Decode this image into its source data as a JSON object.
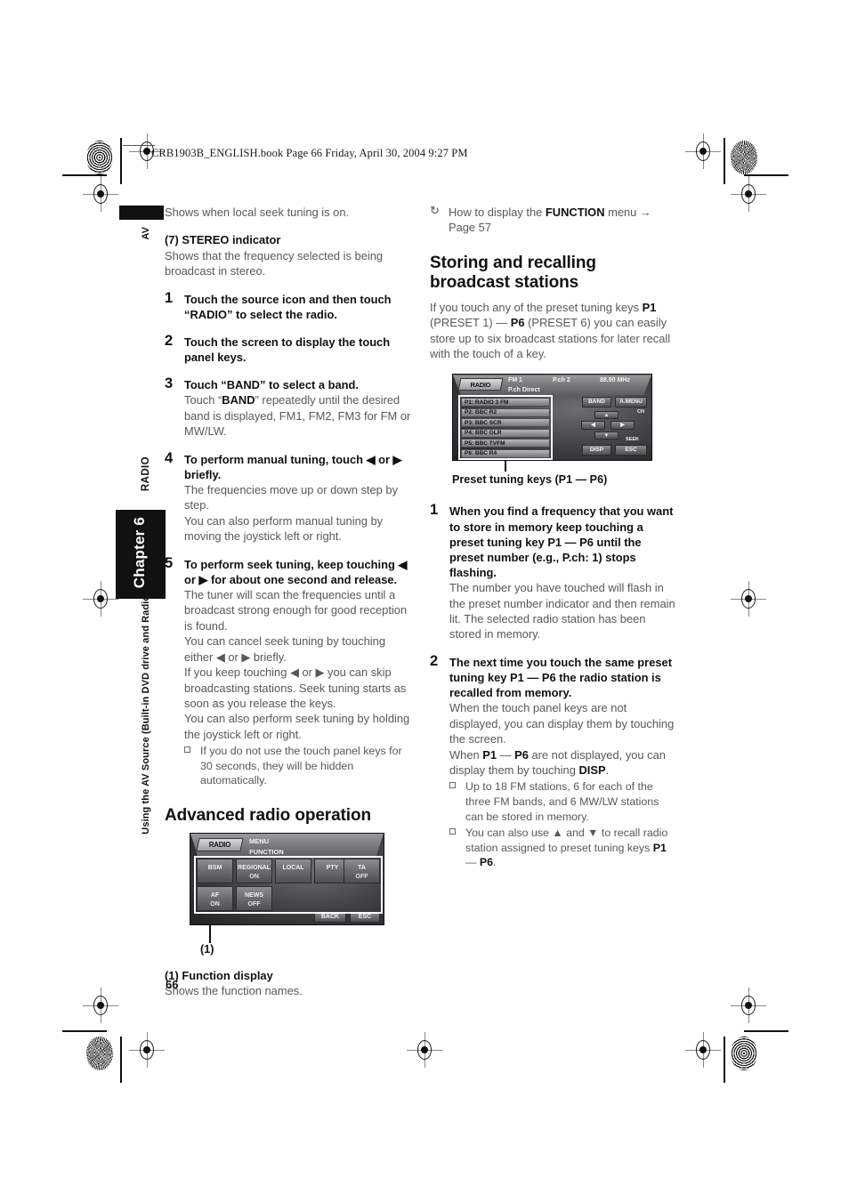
{
  "print_header": "CRB1903B_ENGLISH.book  Page 66  Friday, April 30, 2004  9:27 PM",
  "page_number": "66",
  "margin_tabs": {
    "av": "AV",
    "radio": "RADIO",
    "chapter": "Chapter 6",
    "section": "Using the AV Source (Built-in DVD drive and Radio)"
  },
  "left_column": {
    "local_note": "Shows when local seek tuning is on.",
    "stereo_heading": "(7) STEREO indicator",
    "stereo_body": "Shows that the frequency selected is being broadcast in stereo.",
    "steps": [
      {
        "number": "1",
        "head": "Touch the source icon and then touch “RADIO” to select the radio.",
        "body": []
      },
      {
        "number": "2",
        "head": "Touch the screen to display the touch panel keys.",
        "body": []
      },
      {
        "number": "3",
        "head": "Touch “BAND” to select a band.",
        "body": [
          "Touch “BAND” repeatedly until the desired band is displayed, FM1, FM2, FM3 for FM or MW/LW."
        ]
      },
      {
        "number": "4",
        "head": "To perform manual tuning, touch ◀ or ▶ briefly.",
        "body": [
          "The frequencies move up or down step by step.",
          "You can also perform manual tuning by moving the joystick left or right."
        ]
      },
      {
        "number": "5",
        "head": "To perform seek tuning, keep touching ◀ or ▶ for about one second and release.",
        "body": [
          "The tuner will scan the frequencies until a broadcast strong enough for good reception is found.",
          "You can cancel seek tuning by touching either ◀ or ▶ briefly.",
          "If you keep touching ◀ or ▶ you can skip broadcasting stations. Seek tuning starts as soon as you release the keys.",
          "You can also perform seek tuning by holding the joystick left or right."
        ],
        "notes": [
          "If you do not use the touch panel keys for 30 seconds, they will be hidden automatically."
        ]
      }
    ],
    "advanced_heading": "Advanced radio operation",
    "function_screen": {
      "logo": "RADIO",
      "title_line1": "MENU",
      "title_line2": "FUNCTION",
      "keys": [
        {
          "label": "BSM",
          "value": ""
        },
        {
          "label": "REGIONAL",
          "value": "ON"
        },
        {
          "label": "LOCAL",
          "value": ""
        },
        {
          "label": "PTY",
          "value": ""
        },
        {
          "label": "TA",
          "value": "OFF"
        },
        {
          "label": "AF",
          "value": "ON"
        },
        {
          "label": "NEWS",
          "value": "OFF"
        }
      ],
      "back_key": "BACK",
      "esc_key": "ESC"
    },
    "callout_num": "(1)",
    "callout_heading": "(1) Function display",
    "callout_body": "Shows the function names."
  },
  "right_column": {
    "refer": {
      "text_pre": "How to display the ",
      "bold": "FUNCTION",
      "text_post": " menu → Page 57"
    },
    "section_heading": "Storing and recalling broadcast stations",
    "intro": "If you touch any of the preset tuning keys P1 (PRESET 1) — P6 (PRESET 6) you can easily store up to six broadcast stations for later recall with the touch of a key.",
    "preset_screen": {
      "logo": "RADIO",
      "band": "FM 1",
      "pch": "P.ch 2",
      "freq": "88.90 MHz",
      "subtitle": "P.ch Direct",
      "presets": [
        "P1: RADIO 3 FM",
        "P2: BBC  R2",
        "P3: BBC  SCR",
        "P4: BBC  GLR",
        "P5: BBC  TVFM",
        "P6: BBC  R4"
      ],
      "band_key": "BAND",
      "amenu_key": "A.MENU",
      "disp_key": "DISP",
      "esc_key": "ESC",
      "ch_label": "CH",
      "seek_label": "SEEK"
    },
    "preset_caption": "Preset tuning keys (P1 — P6)",
    "steps": [
      {
        "number": "1",
        "head": "When you find a frequency that you want to store in memory keep touching a preset tuning key P1 — P6 until the preset number (e.g., P.ch: 1) stops flashing.",
        "body": [
          "The number you have touched will flash in the preset number indicator and then remain lit. The selected radio station has been stored in memory."
        ],
        "notes": []
      },
      {
        "number": "2",
        "head": "The next time you touch the same preset tuning key P1 — P6 the radio station is recalled from memory.",
        "body": [
          "When the touch panel keys are not displayed, you can display them by touching the screen.",
          "When P1 — P6 are not displayed, you can display them by touching DISP."
        ],
        "notes": [
          "Up to 18 FM stations, 6 for each of the three FM bands, and 6 MW/LW stations can be stored in memory.",
          "You can also use ▲ and ▼ to recall radio station assigned to preset tuning keys P1 — P6."
        ]
      }
    ]
  }
}
